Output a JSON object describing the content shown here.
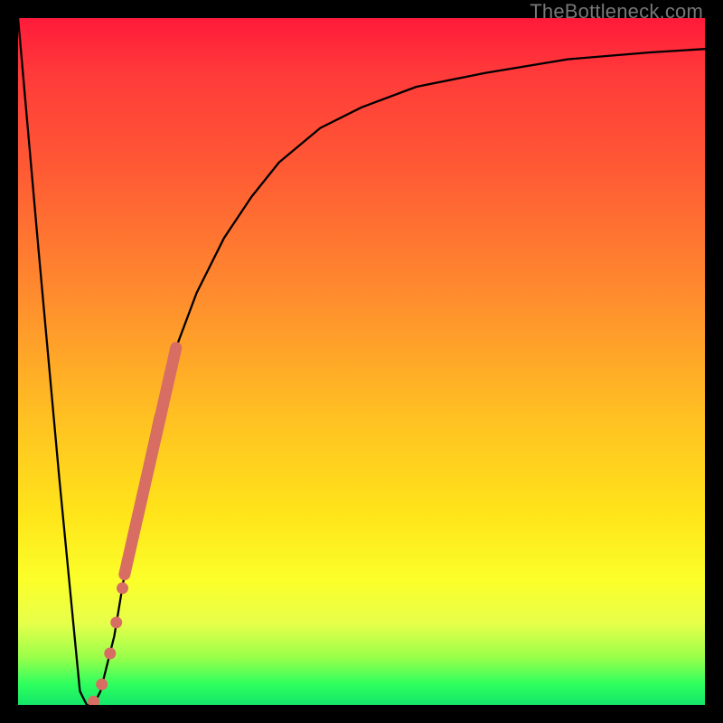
{
  "watermark": "TheBottleneck.com",
  "chart_data": {
    "type": "line",
    "title": "",
    "xlabel": "",
    "ylabel": "",
    "xlim": [
      0,
      100
    ],
    "ylim": [
      0,
      100
    ],
    "series": [
      {
        "name": "curve",
        "x": [
          0,
          3,
          6,
          9,
          10,
          11,
          12,
          14,
          16,
          18,
          20,
          23,
          26,
          30,
          34,
          38,
          44,
          50,
          58,
          68,
          80,
          92,
          100
        ],
        "y": [
          100,
          66,
          33,
          2,
          0,
          0,
          2,
          10,
          22,
          33,
          42,
          52,
          60,
          68,
          74,
          79,
          84,
          87,
          90,
          92,
          94,
          95,
          95.5
        ]
      }
    ],
    "highlight_segment": {
      "name": "thick-stroke",
      "color": "#d86d63",
      "x": [
        15.5,
        23.0
      ],
      "y": [
        19,
        52
      ]
    },
    "markers": {
      "name": "dots",
      "color": "#d86d63",
      "points": [
        {
          "x": 11.0,
          "y": 0.5
        },
        {
          "x": 12.2,
          "y": 3.0
        },
        {
          "x": 13.4,
          "y": 7.5
        },
        {
          "x": 14.3,
          "y": 12.0
        },
        {
          "x": 15.2,
          "y": 17.0
        }
      ]
    }
  }
}
